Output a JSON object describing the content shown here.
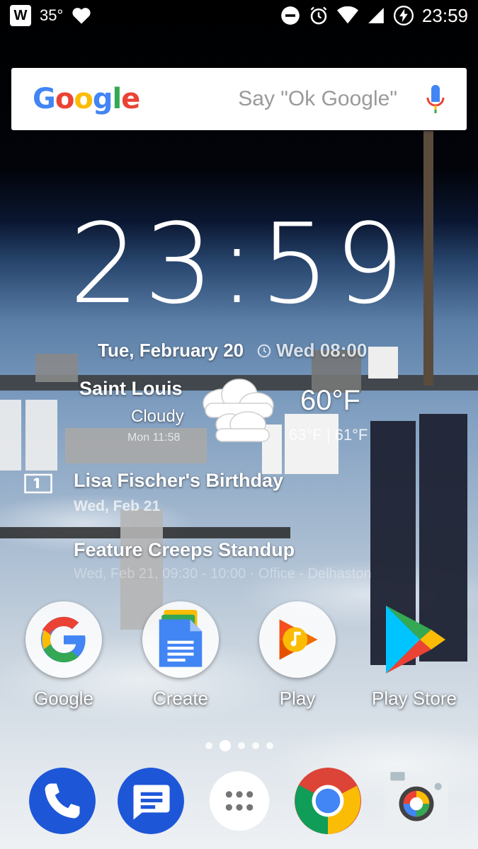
{
  "status_bar": {
    "temperature": "35°",
    "time": "23:59",
    "app_badge": "W"
  },
  "search": {
    "logo": "Google",
    "hint": "Say \"Ok Google\""
  },
  "clock": {
    "time": "23:59"
  },
  "widget": {
    "date": "Tue, February 20",
    "alarm": "Wed 08:00",
    "city": "Saint Louis",
    "condition": "Cloudy",
    "updated": "Mon 11:58",
    "temperature": "60°F",
    "high_low": "63°F | 61°F",
    "events": [
      {
        "title": "Lisa Fischer's Birthday",
        "date": "Wed, Feb 21"
      },
      {
        "title": "Feature Creeps Standup",
        "detail": "Wed, Feb 21, 09:30 - 10:00 · Office - Delhaston"
      }
    ]
  },
  "apps": [
    {
      "label": "Google",
      "icon": "google-icon"
    },
    {
      "label": "Create",
      "icon": "docs-icon"
    },
    {
      "label": "Play",
      "icon": "play-music-icon"
    },
    {
      "label": "Play Store",
      "icon": "play-store-icon"
    }
  ],
  "dock": [
    "phone-icon",
    "messages-icon",
    "app-drawer-icon",
    "chrome-icon",
    "camera-icon"
  ],
  "page_indicator": {
    "count": 5,
    "active": 1
  },
  "colors": {
    "google_blue": "#4285F4",
    "google_red": "#EA4335",
    "google_yellow": "#FBBC05",
    "google_green": "#34A853"
  }
}
